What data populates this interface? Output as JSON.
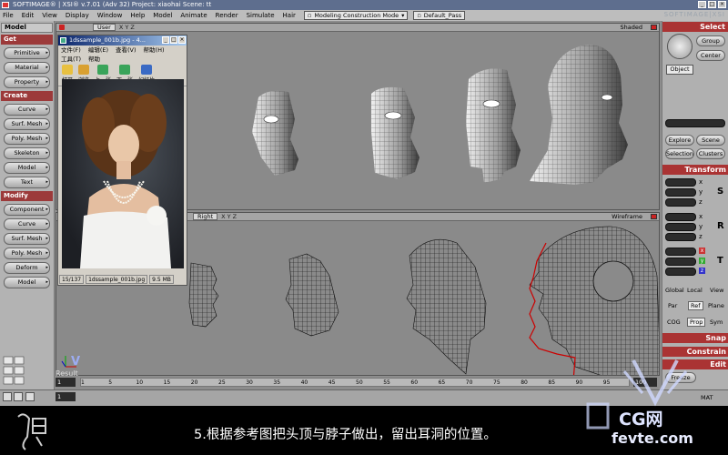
{
  "title": {
    "text": "SOFTIMAGE® | XSI® v.7.01 (Adv 32) Project: xiaohai    Scene: tt",
    "brand": "SOFTIMAGE|XSI"
  },
  "menu": {
    "items": [
      "File",
      "Edit",
      "View",
      "Display",
      "Window",
      "Help",
      "Model",
      "Animate",
      "Render",
      "Simulate",
      "Hair"
    ],
    "mode_dropdown": "Modeling Construction Mode",
    "pass_dropdown": "Default_Pass"
  },
  "left_panel": {
    "module": "Model",
    "sections": [
      {
        "header": "Get",
        "buttons": [
          "Primitive",
          "Material",
          "Property"
        ]
      },
      {
        "header": "Create",
        "buttons": [
          "Curve",
          "Surf. Mesh",
          "Poly. Mesh",
          "Skeleton",
          "Model",
          "Text"
        ]
      },
      {
        "header": "Modify",
        "buttons": [
          "Component",
          "Curve",
          "Surf. Mesh",
          "Poly. Mesh",
          "Deform",
          "Model"
        ]
      }
    ]
  },
  "viewport_top": {
    "camera": "User",
    "axes": "X Y Z",
    "mode": "Shaded"
  },
  "viewport_bottom": {
    "camera": "Right",
    "axes": "X Y Z",
    "mode": "Wireframe"
  },
  "image_viewer": {
    "title": "1dssample_001b.jpg - 4...",
    "menu": [
      "文件(F)",
      "编辑(E)",
      "查看(V)",
      "帮助(H)"
    ],
    "menu_row2": [
      "工具(T)",
      "帮助"
    ],
    "tools": [
      "打开",
      "浏览",
      "上一张",
      "下一张",
      "幻灯片"
    ],
    "status": {
      "index": "15/137",
      "file": "1dssample_001b.jpg",
      "size": "9.5 MB"
    }
  },
  "right_panel": {
    "select": "Select",
    "group": "Group",
    "center": "Center",
    "object": "Object",
    "explore": "Explore",
    "scene": "Scene",
    "selection": "Selection",
    "clusters": "Clusters",
    "transform": "Transform",
    "axis_labels": [
      "x",
      "y",
      "z"
    ],
    "side_labels": [
      "S",
      "R",
      "T"
    ],
    "global": "Global",
    "local": "Local",
    "view": "View",
    "par": "Par",
    "ref": "Ref",
    "plane": "Plane",
    "cog": "COG",
    "prop": "Prop",
    "sym": "Sym",
    "snap": "Snap",
    "constrain": "Constrain",
    "edit": "Edit",
    "freeze": "Freeze",
    "mat": "MAT"
  },
  "timeline": {
    "start": "1",
    "current": "1",
    "end": "100",
    "ticks": [
      "1",
      "5",
      "10",
      "15",
      "20",
      "25",
      "30",
      "35",
      "40",
      "45",
      "50",
      "55",
      "60",
      "65",
      "70",
      "75",
      "80",
      "85",
      "90",
      "95"
    ]
  },
  "result_label": "Result",
  "caption": "5.根据参考图把头顶与脖子做出，留出耳洞的位置。",
  "watermark": {
    "text": "CG网",
    "site": "fevte.com",
    "mark": "V"
  },
  "colors": {
    "accent_red": "#a33333",
    "title_blue": "#5e6e8e"
  }
}
